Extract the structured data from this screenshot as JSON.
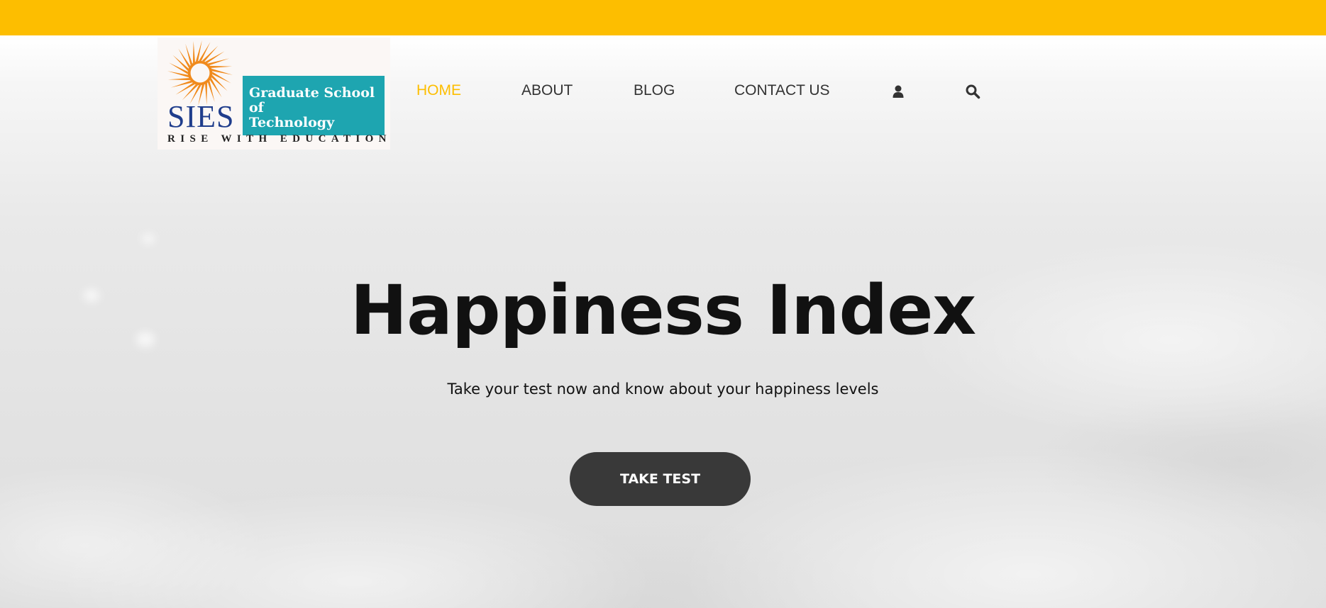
{
  "colors": {
    "accent": "#fdbe00",
    "button": "#393939",
    "text": "#111111",
    "logo_teal": "#1ea5b0",
    "logo_blue": "#1f3d8c",
    "logo_orange": "#f08a1c"
  },
  "logo": {
    "box_line1": "Graduate School of",
    "box_line2": "Technology",
    "wordmark": "SIES",
    "tagline": "RISE WITH EDUCATION",
    "icon": "sun-emblem-icon"
  },
  "nav": {
    "home": "HOME",
    "about": "ABOUT",
    "blog": "BLOG",
    "contact": "CONTACT US",
    "user_icon": "user-icon",
    "search_icon": "search-icon"
  },
  "hero": {
    "title": "Happiness Index",
    "subtitle": "Take your test now and know about your happiness levels",
    "cta": "TAKE TEST"
  }
}
